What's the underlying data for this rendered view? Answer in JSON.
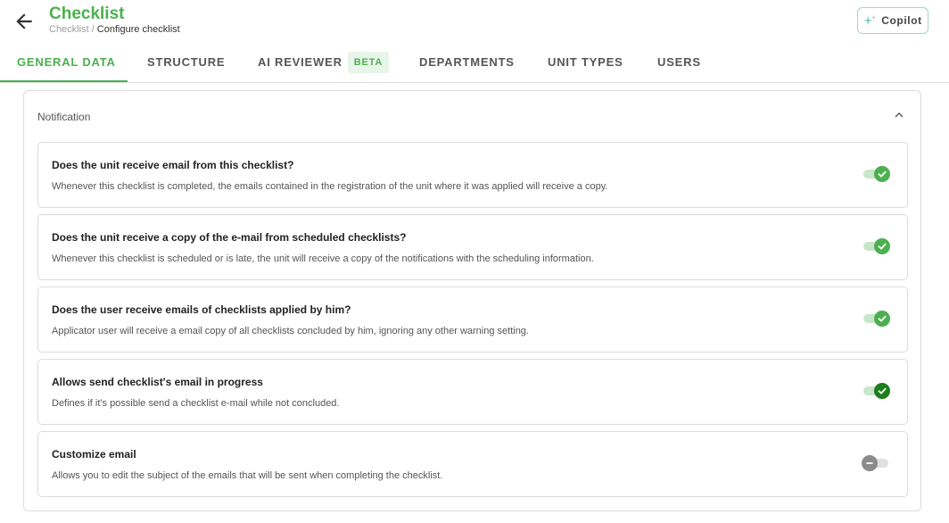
{
  "header": {
    "title": "Checklist",
    "breadcrumb_parent": "Checklist",
    "breadcrumb_separator": " / ",
    "breadcrumb_current": "Configure checklist",
    "copilot_label": "Copilot"
  },
  "tabs": [
    {
      "label": "GENERAL DATA",
      "active": true
    },
    {
      "label": "STRUCTURE",
      "active": false
    },
    {
      "label": "AI REVIEWER",
      "badge": "BETA",
      "active": false
    },
    {
      "label": "DEPARTMENTS",
      "active": false
    },
    {
      "label": "UNIT TYPES",
      "active": false
    },
    {
      "label": "USERS",
      "active": false
    }
  ],
  "panel": {
    "title": "Notification",
    "settings": [
      {
        "title": "Does the unit receive email from this checklist?",
        "description": "Whenever this checklist is completed, the emails contained in the registration of the unit where it was applied will receive a copy.",
        "enabled": true,
        "knob_color": "#4caf50"
      },
      {
        "title": "Does the unit receive a copy of the e-mail from scheduled checklists?",
        "description": "Whenever this checklist is scheduled or is late, the unit will receive a copy of the notifications with the scheduling information.",
        "enabled": true,
        "knob_color": "#4caf50"
      },
      {
        "title": "Does the user receive emails of checklists applied by him?",
        "description": "Applicator user will receive a email copy of all checklists concluded by him, ignoring any other warning setting.",
        "enabled": true,
        "knob_color": "#4caf50"
      },
      {
        "title": "Allows send checklist's email in progress",
        "description": "Defines if it's possible send a checklist e-mail while not concluded.",
        "enabled": true,
        "knob_color": "#1b7f1b"
      },
      {
        "title": "Customize email",
        "description": "Allows you to edit the subject of the emails that will be sent when completing the checklist.",
        "enabled": false,
        "knob_color": "#8a8a8a"
      }
    ]
  },
  "colors": {
    "accent": "#4caf50",
    "copilot_border": "#9ed8c8"
  }
}
